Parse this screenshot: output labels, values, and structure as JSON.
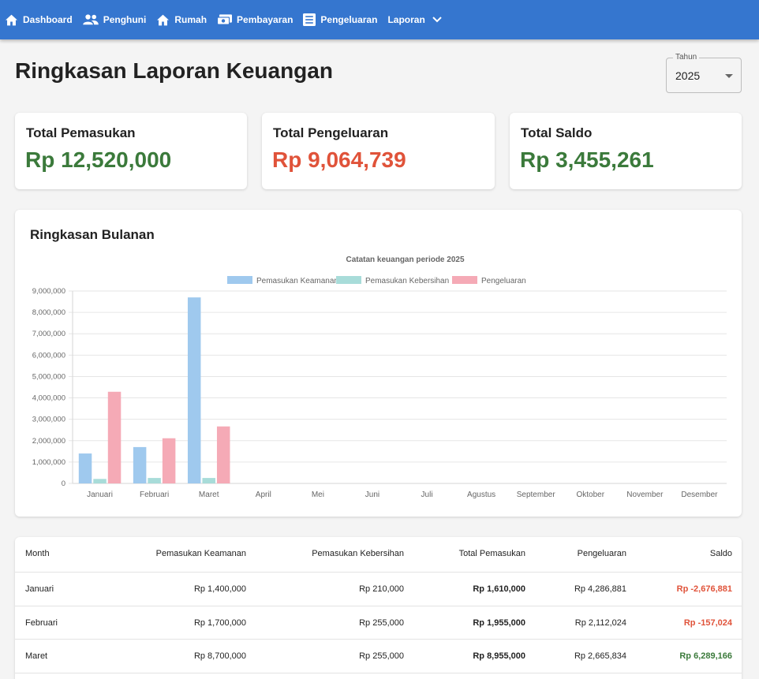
{
  "nav": {
    "items": [
      {
        "label": "Dashboard",
        "icon": "home-icon"
      },
      {
        "label": "Penghuni",
        "icon": "people-icon"
      },
      {
        "label": "Rumah",
        "icon": "home-icon"
      },
      {
        "label": "Pembayaran",
        "icon": "payment-icon"
      },
      {
        "label": "Pengeluaran",
        "icon": "list-icon"
      },
      {
        "label": "Laporan",
        "icon": "chevron-down-icon"
      }
    ]
  },
  "page": {
    "title": "Ringkasan Laporan Keuangan",
    "year_label": "Tahun",
    "year_value": "2025"
  },
  "summary": {
    "income": {
      "label": "Total Pemasukan",
      "value": "Rp 12,520,000",
      "color": "#3b7a3b"
    },
    "expense": {
      "label": "Total Pengeluaran",
      "value": "Rp 9,064,739",
      "color": "#e0533a"
    },
    "balance": {
      "label": "Total Saldo",
      "value": "Rp 3,455,261",
      "color": "#3b7a3b"
    }
  },
  "chart_section": {
    "heading": "Ringkasan Bulanan"
  },
  "chart_data": {
    "type": "bar",
    "title": "Catatan keuangan periode 2025",
    "categories": [
      "Januari",
      "Februari",
      "Maret",
      "April",
      "Mei",
      "Juni",
      "Juli",
      "Agustus",
      "September",
      "Oktober",
      "November",
      "Desember"
    ],
    "series": [
      {
        "name": "Pemasukan Keamanan",
        "color": "#9fc9ee",
        "values": [
          1400000,
          1700000,
          8700000,
          0,
          0,
          0,
          0,
          0,
          0,
          0,
          0,
          0
        ]
      },
      {
        "name": "Pemasukan Kebersihan",
        "color": "#a8dcd9",
        "values": [
          210000,
          255000,
          255000,
          0,
          0,
          0,
          0,
          0,
          0,
          0,
          0,
          0
        ]
      },
      {
        "name": "Pengeluaran",
        "color": "#f5aab6",
        "values": [
          4286881,
          2112024,
          2665834,
          0,
          0,
          0,
          0,
          0,
          0,
          0,
          0,
          0
        ]
      }
    ],
    "ylim": [
      0,
      9000000
    ],
    "yticks": [
      "0",
      "1,000,000",
      "2,000,000",
      "3,000,000",
      "4,000,000",
      "5,000,000",
      "6,000,000",
      "7,000,000",
      "8,000,000",
      "9,000,000"
    ],
    "legend": "top",
    "grid": true
  },
  "table": {
    "headers": [
      "Month",
      "Pemasukan Keamanan",
      "Pemasukan Kebersihan",
      "Total Pemasukan",
      "Pengeluaran",
      "Saldo"
    ],
    "rows": [
      {
        "month": "Januari",
        "keamanan": "Rp 1,400,000",
        "kebersihan": "Rp 210,000",
        "total": "Rp 1,610,000",
        "pengeluaran": "Rp 4,286,881",
        "saldo": "Rp -2,676,881",
        "saldo_color": "#e0533a"
      },
      {
        "month": "Februari",
        "keamanan": "Rp 1,700,000",
        "kebersihan": "Rp 255,000",
        "total": "Rp 1,955,000",
        "pengeluaran": "Rp 2,112,024",
        "saldo": "Rp -157,024",
        "saldo_color": "#e0533a"
      },
      {
        "month": "Maret",
        "keamanan": "Rp 8,700,000",
        "kebersihan": "Rp 255,000",
        "total": "Rp 8,955,000",
        "pengeluaran": "Rp 2,665,834",
        "saldo": "Rp 6,289,166",
        "saldo_color": "#3b7a3b"
      }
    ]
  }
}
